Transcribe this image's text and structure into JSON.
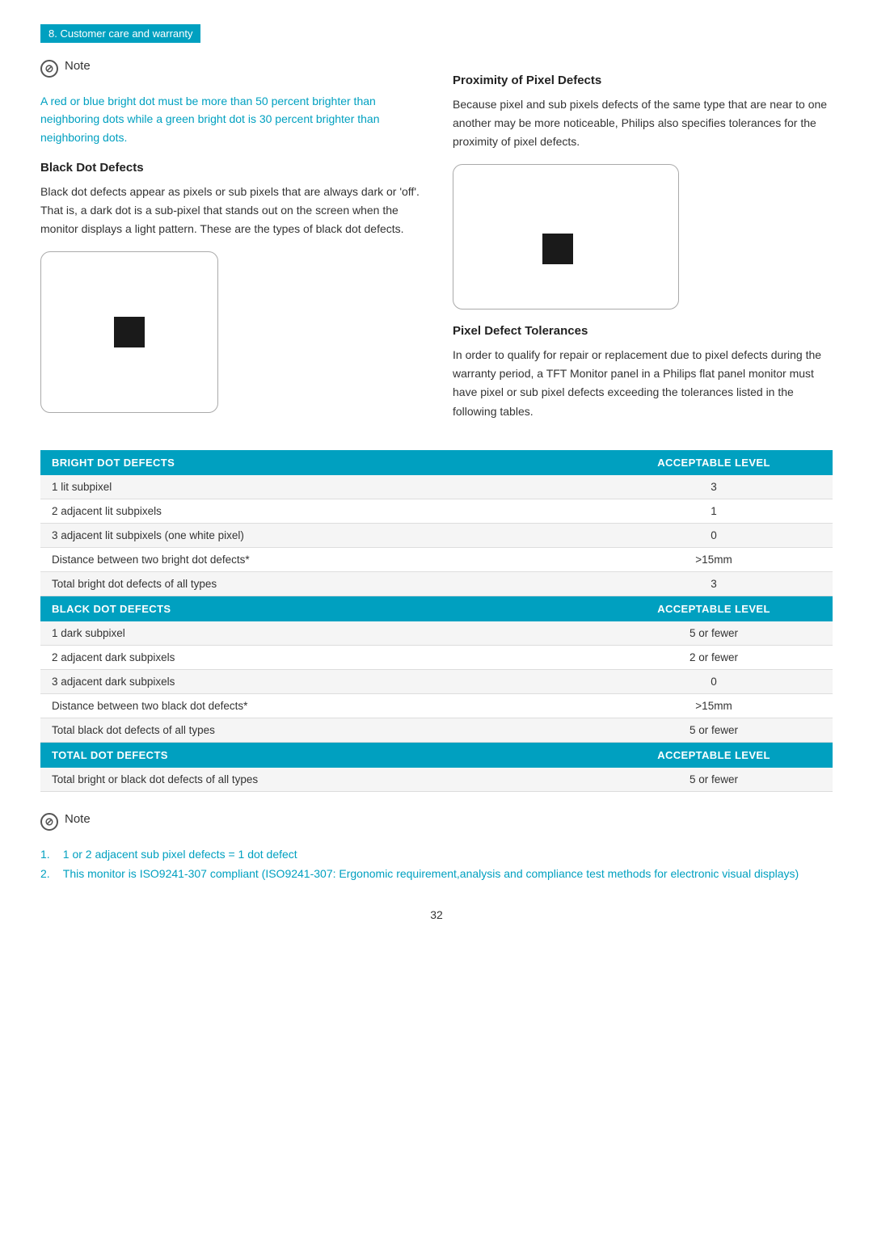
{
  "breadcrumb": {
    "text": "8. Customer care and warranty"
  },
  "note_section": {
    "label": "Note",
    "text": "A red or blue bright dot must be more than 50 percent brighter than neighboring dots while a green bright dot is 30 percent brighter than neighboring dots."
  },
  "left_column": {
    "black_dot_heading": "Black Dot Defects",
    "black_dot_body": "Black dot defects appear as pixels or sub pixels that are always dark or 'off'. That is, a dark dot is a sub-pixel that stands out on the screen when the monitor displays a light pattern. These are the types of black dot defects."
  },
  "right_column": {
    "proximity_heading": "Proximity of Pixel Defects",
    "proximity_body": "Because pixel and sub pixels defects of the same type that are near to one another may be more noticeable, Philips also specifies tolerances for the proximity of pixel defects.",
    "tolerance_heading": "Pixel Defect Tolerances",
    "tolerance_body": "In order to qualify for repair or replacement due to pixel defects during the warranty period, a TFT Monitor panel in a Philips flat panel monitor must have pixel or sub pixel defects exceeding the tolerances listed in the following tables."
  },
  "table": {
    "bright_dot_header": "BRIGHT DOT DEFECTS",
    "bright_dot_level": "ACCEPTABLE LEVEL",
    "bright_dot_rows": [
      {
        "label": "1 lit subpixel",
        "value": "3"
      },
      {
        "label": "2 adjacent lit subpixels",
        "value": "1"
      },
      {
        "label": "3 adjacent lit subpixels (one white pixel)",
        "value": "0"
      },
      {
        "label": "Distance between two bright dot defects*",
        "value": ">15mm"
      },
      {
        "label": "Total bright dot defects of all types",
        "value": "3"
      }
    ],
    "black_dot_header": "BLACK DOT DEFECTS",
    "black_dot_level": "ACCEPTABLE LEVEL",
    "black_dot_rows": [
      {
        "label": "1 dark subpixel",
        "value": "5 or fewer"
      },
      {
        "label": "2 adjacent dark subpixels",
        "value": "2 or fewer"
      },
      {
        "label": "3 adjacent dark subpixels",
        "value": "0"
      },
      {
        "label": "Distance between two black dot defects*",
        "value": ">15mm"
      },
      {
        "label": "Total black dot defects of all types",
        "value": "5 or fewer"
      }
    ],
    "total_dot_header": "TOTAL DOT DEFECTS",
    "total_dot_level": "ACCEPTABLE LEVEL",
    "total_dot_rows": [
      {
        "label": "Total bright or black dot defects of all types",
        "value": "5 or fewer"
      }
    ]
  },
  "bottom_note": {
    "label": "Note",
    "items": [
      "1 or 2 adjacent sub pixel defects = 1 dot defect",
      "This monitor is ISO9241-307 compliant (ISO9241-307: Ergonomic requirement,analysis and compliance test methods for electronic visual displays)"
    ]
  },
  "page_number": "32"
}
